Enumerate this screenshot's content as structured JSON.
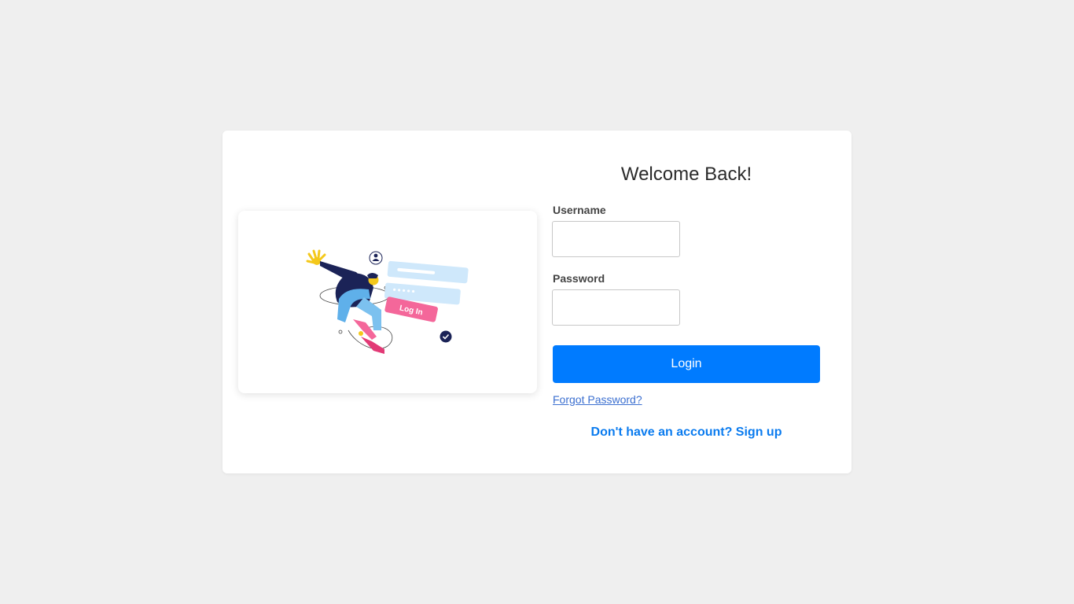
{
  "login_card": {
    "title": "Welcome Back!",
    "username_label": "Username",
    "username_value": "",
    "password_label": "Password",
    "password_value": "",
    "login_button": "Login",
    "forgot_link": "Forgot Password?",
    "signup_link": "Don't have an account? Sign up"
  },
  "illustration": {
    "button_text": "Log In",
    "icons": [
      "user-icon",
      "check-icon"
    ]
  },
  "colors": {
    "page_bg": "#efefef",
    "card_bg": "#ffffff",
    "primary": "#007bff",
    "link": "#3b6fd0",
    "accent_pink": "#f4679a",
    "accent_light_blue": "#cfe8fb",
    "accent_navy": "#1b2357"
  }
}
